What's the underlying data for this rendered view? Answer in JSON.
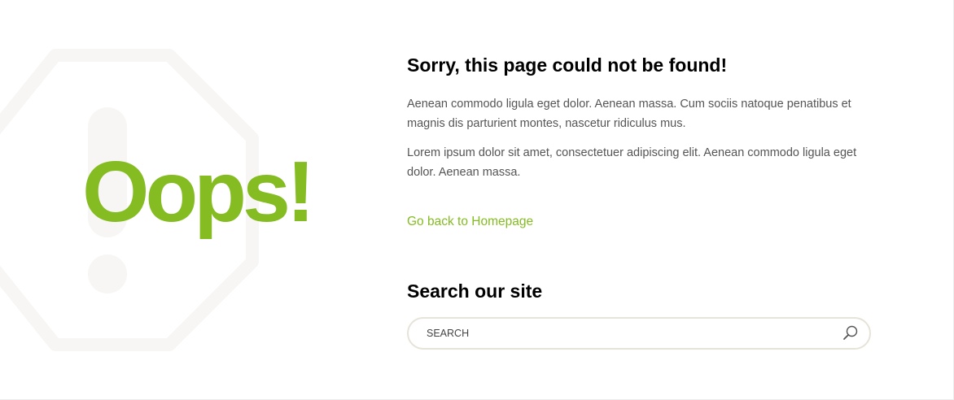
{
  "hero": {
    "headline": "Oops!",
    "background_icon": "stop-sign-exclamation-icon"
  },
  "content": {
    "title": "Sorry, this page could not be found!",
    "paragraph_1": "Aenean commodo ligula eget dolor. Aenean massa. Cum sociis natoque penatibus et magnis dis parturient montes, nascetur ridiculus mus.",
    "paragraph_2": "Lorem ipsum dolor sit amet, consectetuer adipiscing elit. Aenean commodo ligula eget dolor. Aenean massa.",
    "home_link": "Go back to Homepage"
  },
  "search": {
    "title": "Search our site",
    "placeholder": "SEARCH",
    "value": "",
    "button_icon": "search-icon"
  },
  "colors": {
    "accent": "#84bc22",
    "heading": "#000000",
    "body_text": "#555555",
    "watermark": "#f7f6f4",
    "input_border": "#e6e3d8"
  }
}
